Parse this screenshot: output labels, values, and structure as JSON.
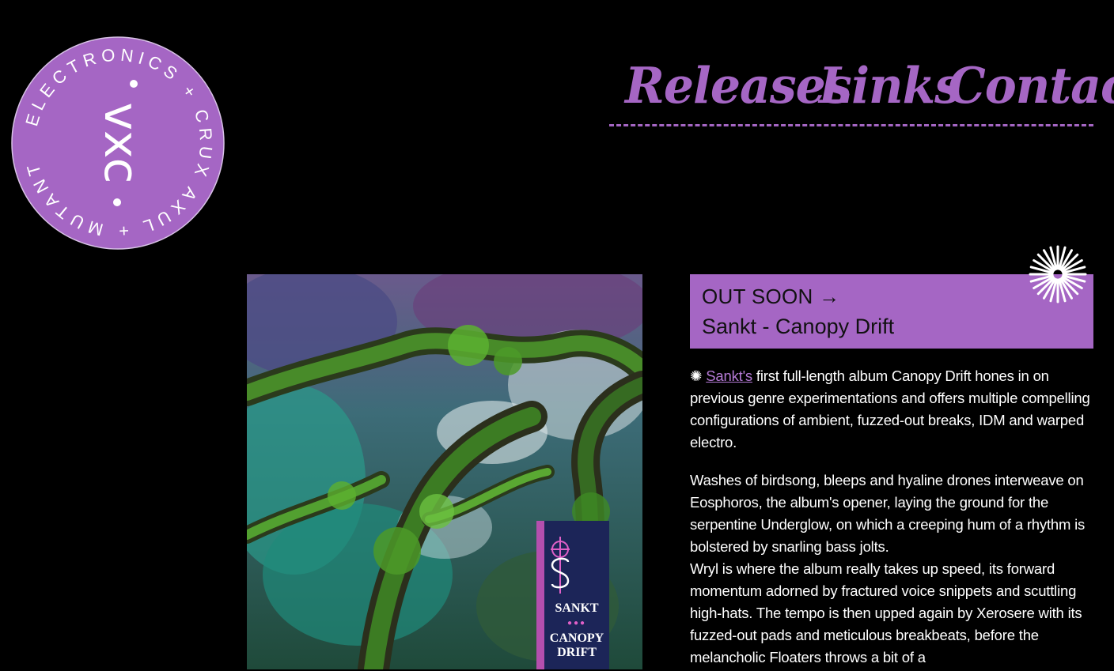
{
  "brand": {
    "ring_text": "ELECTRONICS + CRUX AXUL + MUTANT",
    "monogram": "vxc",
    "color": "#a566c4"
  },
  "nav": {
    "items": [
      {
        "label": "Releases"
      },
      {
        "label": "Links"
      },
      {
        "label": "Contact"
      }
    ]
  },
  "release": {
    "status": "OUT SOON",
    "arrow": "→",
    "title": "Sankt - Canopy Drift",
    "cover": {
      "artist": "SANKT",
      "dots": "●●●",
      "album_line1": "CANOPY",
      "album_line2": "DRIFT"
    }
  },
  "description": {
    "p1_bullet": "✺",
    "p1_link": "Sankt's",
    "p1_text": " first full-length album Canopy Drift hones in on previous genre experimentations and offers multiple compelling configurations of ambient, fuzzed-out breaks, IDM and warped electro.",
    "p2": "Washes of birdsong, bleeps and hyaline drones interweave on Eosphoros, the album's opener, laying the ground for the serpentine Underglow, on which a creeping hum of a rhythm is bolstered by snarling bass jolts.",
    "p3": "Wryl is where the album really takes up speed, its forward momentum adorned by fractured voice snippets and scuttling high-hats. The tempo is then upped again by Xerosere with its fuzzed-out pads and meticulous breakbeats, before the melancholic Floaters throws a bit of a"
  },
  "colors": {
    "accent": "#a566c4",
    "background": "#000000",
    "link": "#b57ad6"
  }
}
